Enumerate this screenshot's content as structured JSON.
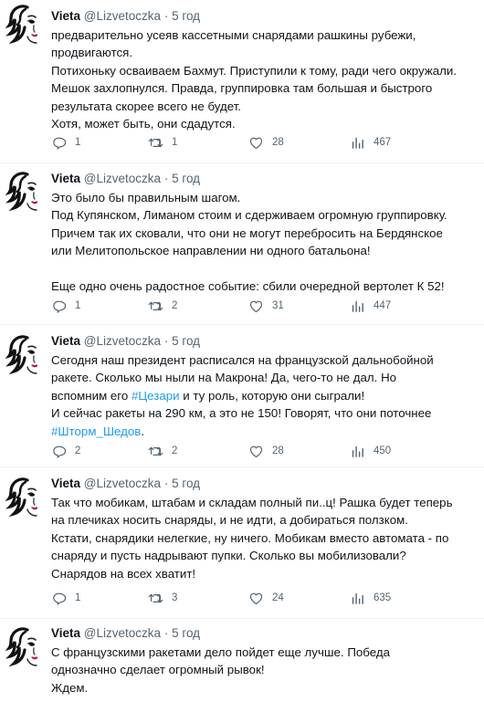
{
  "tweets": [
    {
      "author": "Vieta",
      "handle": "@Lizvetoczka",
      "separator": "·",
      "time": "5 год",
      "lines": [
        "предварительно усеяв кассетными снарядами рашкины рубежи,",
        "продвигаются.",
        "Потихоньку осваиваем Бахмут. Приступили к тому, ради чего окружали.",
        "Мешок захлопнулся. Правда, группировка там большая и быстрого",
        "результата скорее всего не будет.",
        "Хотя, может быть, они сдадутся."
      ],
      "replies": "1",
      "retweets": "1",
      "likes": "28",
      "views": "467"
    },
    {
      "author": "Vieta",
      "handle": "@Lizvetoczka",
      "separator": "·",
      "time": "5 год",
      "lines": [
        "Это было бы правильным шагом.",
        "Под Купянском, Лиманом стоим и сдерживаем огромную группировку.",
        "Причем так их сковали, что они не могут перебросить на Бердянское",
        "или Мелитопольское направлении ни одного батальона!",
        "",
        "Еще одно очень радостное событие: сбили очередной вертолет К 52!"
      ],
      "replies": "1",
      "retweets": "2",
      "likes": "31",
      "views": "447"
    },
    {
      "author": "Vieta",
      "handle": "@Lizvetoczka",
      "separator": "·",
      "time": "5 год",
      "lines_pre": [
        "Сегодня наш президент расписался на французской дальнобойной",
        "ракете. Сколько мы ныли на Макрона! Да, чего-то не дал. Но"
      ],
      "line3_before": "вспомним его ",
      "hashtag1": "#Цезари",
      "line3_after": " и ту роль, которую они сыграли!",
      "line4": "И сейчас ракеты на 290 км, а это не 150! Говорят, что они поточнее",
      "hashtag2": "#Шторм_Шедов",
      "hashtag2_after": ".",
      "replies": "2",
      "retweets": "2",
      "likes": "28",
      "views": "450"
    },
    {
      "author": "Vieta",
      "handle": "@Lizvetoczka",
      "separator": "·",
      "time": "5 год",
      "lines": [
        "Так что мобикам, штабам и складам полный пи..ц! Рашка будет теперь",
        "на плечиках носить снаряды, и не идти, а добираться ползком.",
        "Кстати, снарядики нелегкие, ну ничего. Мобикам вместо автомата - по",
        "снаряду и пусть надрывают пупки. Сколько вы мобилизовали?",
        "Снарядов на всех хватит!"
      ],
      "replies": "1",
      "retweets": "3",
      "likes": "24",
      "views": "635"
    },
    {
      "author": "Vieta",
      "handle": "@Lizvetoczka",
      "separator": "·",
      "time": "5 год",
      "lines": [
        "С французскими ракетами дело пойдет еще лучше. Победа",
        "однозначно сделает огромный рывок!",
        "Ждем."
      ]
    }
  ],
  "colors": {
    "text": "#0f1419",
    "muted": "#536471",
    "link": "#1d9bf0",
    "divider": "#eff3f4"
  },
  "icons": [
    "avatar-icon",
    "reply-icon",
    "retweet-icon",
    "like-icon",
    "views-icon"
  ]
}
